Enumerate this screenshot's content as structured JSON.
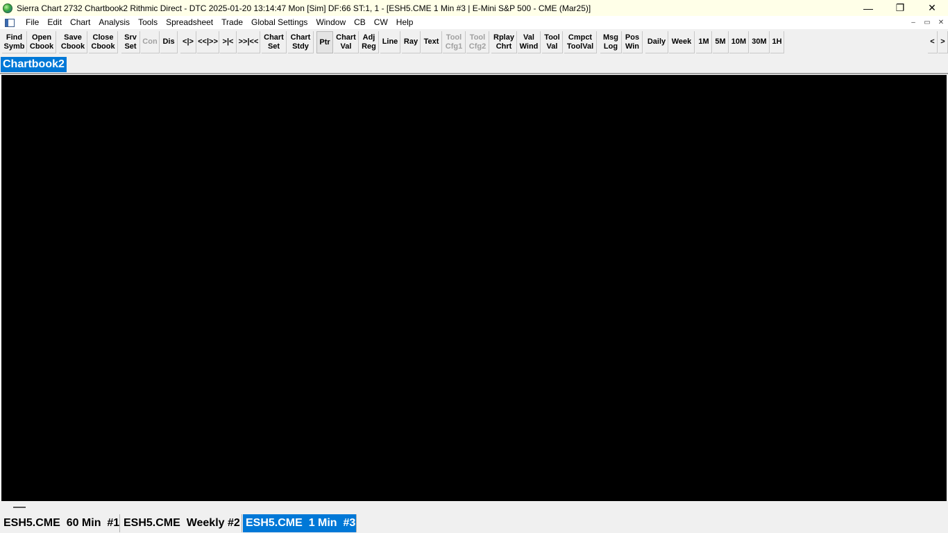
{
  "titlebar": {
    "title": "Sierra Chart 2732 Chartbook2 Rithmic Direct - DTC 2025-01-20  13:14:47 Mon [Sim] DF:66  ST:1, 1 - [ESH5.CME  1 Min  #3 | E-Mini S&P 500 - CME (Mar25)]",
    "minimize": "—",
    "restore": "❐",
    "close": "✕"
  },
  "menubar": {
    "items": [
      "File",
      "Edit",
      "Chart",
      "Analysis",
      "Tools",
      "Spreadsheet",
      "Trade",
      "Global Settings",
      "Window",
      "CB",
      "CW",
      "Help"
    ],
    "mdi_minimize": "–",
    "mdi_restore": "▭",
    "mdi_close": "✕"
  },
  "toolbar": {
    "buttons": [
      {
        "l1": "Find",
        "l2": "Symb"
      },
      {
        "l1": "Open",
        "l2": "Cbook"
      },
      {
        "l1": "Save",
        "l2": "Cbook"
      },
      {
        "l1": "Close",
        "l2": "Cbook"
      },
      {
        "l1": "Srv",
        "l2": "Set"
      },
      {
        "l1": "Con",
        "l2": ""
      },
      {
        "l1": "Dis",
        "l2": ""
      },
      {
        "l1": "<|>",
        "l2": ""
      },
      {
        "l1": "<<|>>",
        "l2": ""
      },
      {
        "l1": ">|<",
        "l2": ""
      },
      {
        "l1": ">>|<<",
        "l2": ""
      },
      {
        "l1": "Chart",
        "l2": "Set"
      },
      {
        "l1": "Chart",
        "l2": "Stdy"
      },
      {
        "l1": "Ptr",
        "l2": ""
      },
      {
        "l1": "Chart",
        "l2": "Val"
      },
      {
        "l1": "Adj",
        "l2": "Reg"
      },
      {
        "l1": "Line",
        "l2": ""
      },
      {
        "l1": "Ray",
        "l2": ""
      },
      {
        "l1": "Text",
        "l2": ""
      },
      {
        "l1": "Tool",
        "l2": "Cfg1"
      },
      {
        "l1": "Tool",
        "l2": "Cfg2"
      },
      {
        "l1": "Rplay",
        "l2": "Chrt"
      },
      {
        "l1": "Val",
        "l2": "Wind"
      },
      {
        "l1": "Tool",
        "l2": "Val"
      },
      {
        "l1": "Cmpct",
        "l2": "ToolVal"
      },
      {
        "l1": "Msg",
        "l2": "Log"
      },
      {
        "l1": "Pos",
        "l2": "Win"
      },
      {
        "l1": "Daily",
        "l2": ""
      },
      {
        "l1": "Week",
        "l2": ""
      },
      {
        "l1": "1M",
        "l2": ""
      },
      {
        "l1": "5M",
        "l2": ""
      },
      {
        "l1": "10M",
        "l2": ""
      },
      {
        "l1": "30M",
        "l2": ""
      },
      {
        "l1": "1H",
        "l2": ""
      }
    ],
    "scroll_left": "<",
    "scroll_right": ">"
  },
  "chartbook_tab": "Chartbook2",
  "chart_tabs": [
    {
      "label": "ESH5.CME  60 Min  #1",
      "active": false
    },
    {
      "label": "ESH5.CME  Weekly #2",
      "active": false
    },
    {
      "label": "ESH5.CME  1 Min  #3",
      "active": true
    }
  ]
}
